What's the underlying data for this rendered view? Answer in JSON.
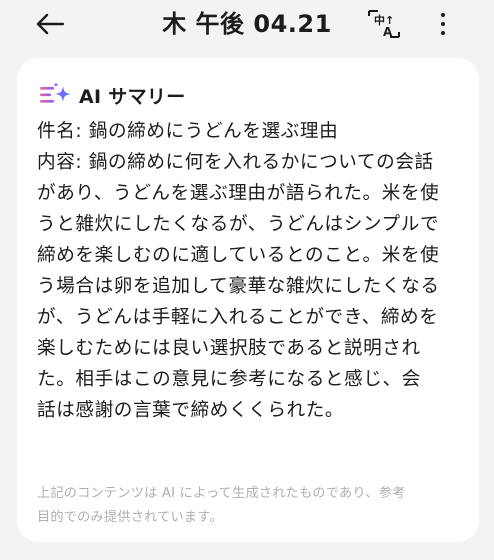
{
  "header": {
    "title": "木 午後 04.21",
    "translate_top": "中↑",
    "translate_bottom": "A"
  },
  "summary": {
    "heading": "AI サマリー",
    "subject_label": "件名:",
    "subject_value": "鍋の締めにうどんを選ぶ理由",
    "content_label": "内容:",
    "content_lines": [
      "鍋の締めに何を入れるかについての会話",
      "があり、うどんを選ぶ理由が語られた。米を使",
      "うと雑炊にしたくなるが、うどんはシンプルで",
      "締めを楽しむのに適しているとのこと。米を使",
      "う場合は卵を追加して豪華な雑炊にしたくなる",
      "が、うどんは手軽に入れることができ、締めを",
      "楽しむためには良い選択肢であると説明され",
      "た。相手はこの意見に参考になると感じ、会",
      "話は感謝の言葉で締めくくられた。"
    ],
    "disclaimer_lines": [
      "上記のコンテンツは AI によって生成されたものであり、参考",
      "目的でのみ提供されています。"
    ]
  },
  "colors": {
    "background": "#f3f3f5",
    "card": "#ffffff",
    "text": "#1c1c1e",
    "disclaimer": "#b0b0b4",
    "icon_purple": "#8a5cf6",
    "icon_blue": "#4c7cf3",
    "icon_pink": "#e96a8d"
  }
}
